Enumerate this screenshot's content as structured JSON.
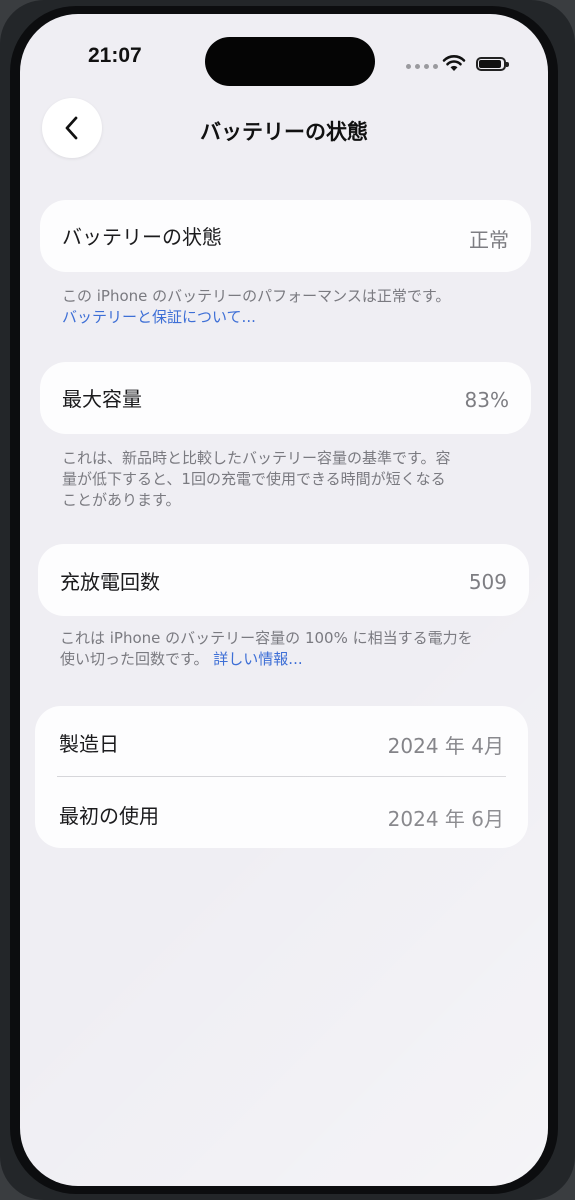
{
  "status_bar": {
    "time": "21:07",
    "battery_level": 0.9
  },
  "header": {
    "title": "バッテリーの状態",
    "back_icon": "chevron-left-icon"
  },
  "battery_health": {
    "label": "バッテリーの状態",
    "value": "正常",
    "note": "この iPhone のバッテリーのパフォーマンスは正常です。",
    "link": "バッテリーと保証について..."
  },
  "max_capacity": {
    "label": "最大容量",
    "value": "83%",
    "note_line1": "これは、新品時と比較したバッテリー容量の基準です。容",
    "note_line2": "量が低下すると、1回の充電で使用できる時間が短くなる",
    "note_line3": "ことがあります。"
  },
  "cycle_count": {
    "label": "充放電回数",
    "value": "509",
    "note_line1": "これは iPhone のバッテリー容量の 100% に相当する電力を",
    "note_line2": "使い切った回数です。",
    "link": "詳しい情報..."
  },
  "dates": {
    "manufacture_label": "製造日",
    "manufacture_value": "2024 年 4月",
    "first_use_label": "最初の使用",
    "first_use_value": "2024 年 6月"
  }
}
